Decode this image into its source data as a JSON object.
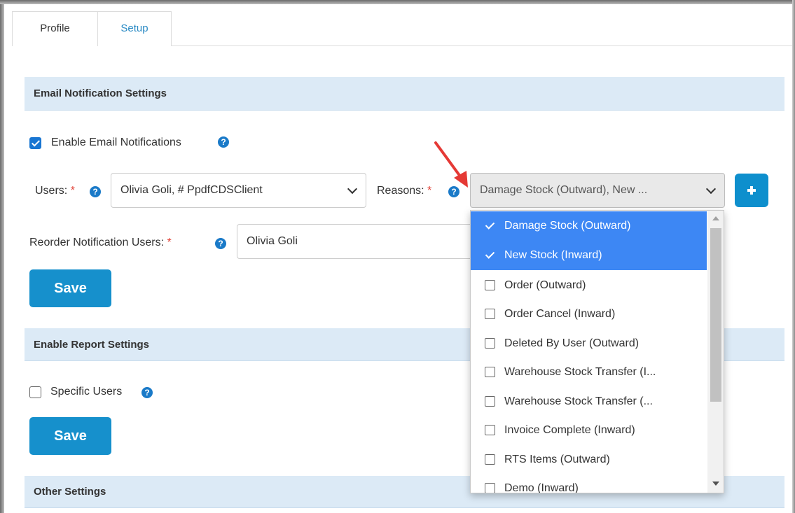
{
  "tabs": [
    {
      "label": "Profile"
    },
    {
      "label": "Setup"
    }
  ],
  "sections": {
    "email": {
      "title": "Email Notification Settings",
      "enable_label": "Enable Email Notifications",
      "enable_checked": true,
      "users_label": "Users:",
      "users_value": "Olivia Goli, # PpdfCDSClient",
      "reasons_label": "Reasons:",
      "reasons_value": "Damage Stock (Outward), New ...",
      "reorder_label": "Reorder Notification Users:",
      "reorder_value": "Olivia Goli",
      "required_mark": "*",
      "save_label": "Save"
    },
    "report": {
      "title": "Enable Report Settings",
      "specific_label": "Specific Users",
      "specific_checked": false,
      "save_label": "Save"
    },
    "other": {
      "title": "Other Settings"
    }
  },
  "help_icon_glyph": "?",
  "reasons_dropdown": {
    "items": [
      {
        "label": "Damage Stock (Outward)",
        "checked": true
      },
      {
        "label": "New Stock (Inward)",
        "checked": true
      },
      {
        "label": "Order (Outward)",
        "checked": false
      },
      {
        "label": "Order Cancel (Inward)",
        "checked": false
      },
      {
        "label": "Deleted By User (Outward)",
        "checked": false
      },
      {
        "label": "Warehouse Stock Transfer (I...",
        "checked": false
      },
      {
        "label": "Warehouse Stock Transfer (...",
        "checked": false
      },
      {
        "label": "Invoice Complete (Inward)",
        "checked": false
      },
      {
        "label": "RTS Items (Outward)",
        "checked": false
      },
      {
        "label": "Demo (Inward)",
        "checked": false
      }
    ]
  },
  "colors": {
    "accent": "#1690cc",
    "section_bg": "#dceaf6",
    "selected_item": "#3d87f4",
    "required": "#e03c31",
    "annotation_arrow": "#e53935"
  }
}
